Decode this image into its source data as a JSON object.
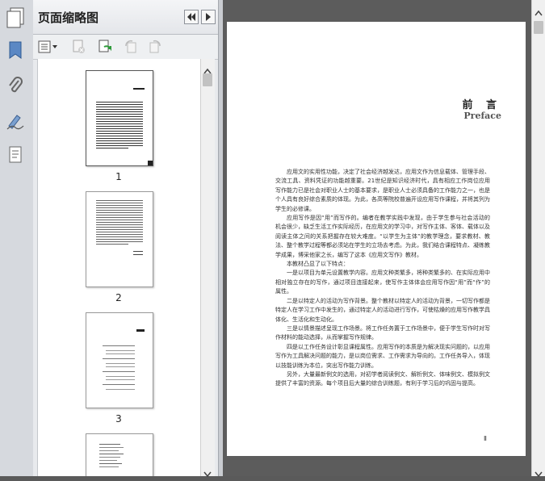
{
  "panel": {
    "title": "页面缩略图",
    "thumbnails": [
      {
        "label": "1"
      },
      {
        "label": "2"
      },
      {
        "label": "3"
      }
    ]
  },
  "document": {
    "heading": "前 言",
    "heading_en": "Preface",
    "paragraphs": [
      "应用文的实用性功能，决定了社会经济越发达，应用文作为信息载体、管理手段、交流工具、资料凭证的功能越重要。21世纪是知识经济时代，具有相应工作岗位应用写作能力已是社会对职业人士的基本要求，是职业人士必须具备的工作能力之一，也是个人具有良好综合素质的体现。为此，各高等院校普遍开设应用写作课程，并将其列为学生的必修课。",
      "应用写作是因“用”而写作的。编者在教学实践中发现，由于学生参与社会活动的机会很少，缺乏生活工作实际经历，在应用文的学习中，对写作主体、客体、载体以及阅读主体之间的关系把握存在较大难度。“以学生为主体”的教学理念，要求教材、教法、整个教学过程等都必须站在学生的立场去考虑。为此，我们结合课程特点、凝练教学成果，博采他家之长，编写了这本《应用文写作》教材。",
      "本教材凸显了以下特点：",
      "一是以项目为单元设置教学内容。应用文种类繁多，将种类繁多的、在实际应用中相对独立存在的写作，通过项目连接起来，使写作主体体会应用写作因“用”而“作”的属性。",
      "二是以特定人的活动为写作背景。整个教材以特定人的活动为背景，一切写作都是特定人在学习工作中发生的，通过特定人的活动进行写作，可使枯燥的应用写作教学具体化、生活化和生动化。",
      "三是以情景描述呈现工作场景。将工作任务置于工作场景中，便于学生写作时对写作材料的能动选择，从而掌握写作规律。",
      "四是以工作任务设计彰显课程属性。应用写作的本质是为解决现实问题的，以应用写作为工具解决问题的能力，是以岗位需求、工作需求为导向的。工作任务导入，体现以技能训练为本位，突出写作能力训练。",
      "另外，大量最新例文的选用，对初学者阅读例文、解析例文、体味例文、模拟例文提供了丰富的资源。每个项目后大量的综合训练题，有利于学习后的巩固与提高。"
    ],
    "page_number": "Ⅱ"
  }
}
